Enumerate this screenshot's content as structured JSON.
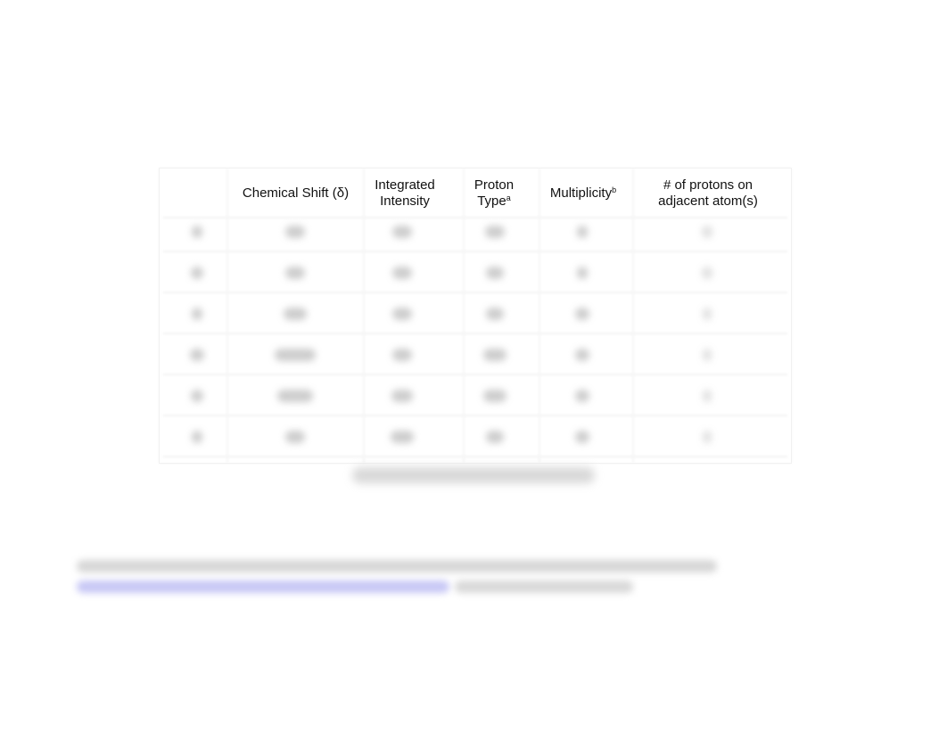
{
  "table": {
    "headers": [
      {
        "text": "",
        "sup": ""
      },
      {
        "text": "Chemical Shift (δ)",
        "sup": ""
      },
      {
        "text": "Integrated Intensity",
        "sup": ""
      },
      {
        "text": "Proton Type",
        "sup": "a"
      },
      {
        "text": "Multiplicity",
        "sup": "b"
      },
      {
        "text": "# of protons on adjacent atom(s)",
        "sup": ""
      }
    ],
    "row_count": 6,
    "rows_note": "cell values are blurred and unreadable"
  },
  "caption": {
    "text": "",
    "note": "blurred"
  },
  "footnote": {
    "line1": "",
    "link": "",
    "link_suffix": "",
    "note": "blurred"
  },
  "colors": {
    "link": "#b9b9f3",
    "border": "#f1f1f1"
  }
}
